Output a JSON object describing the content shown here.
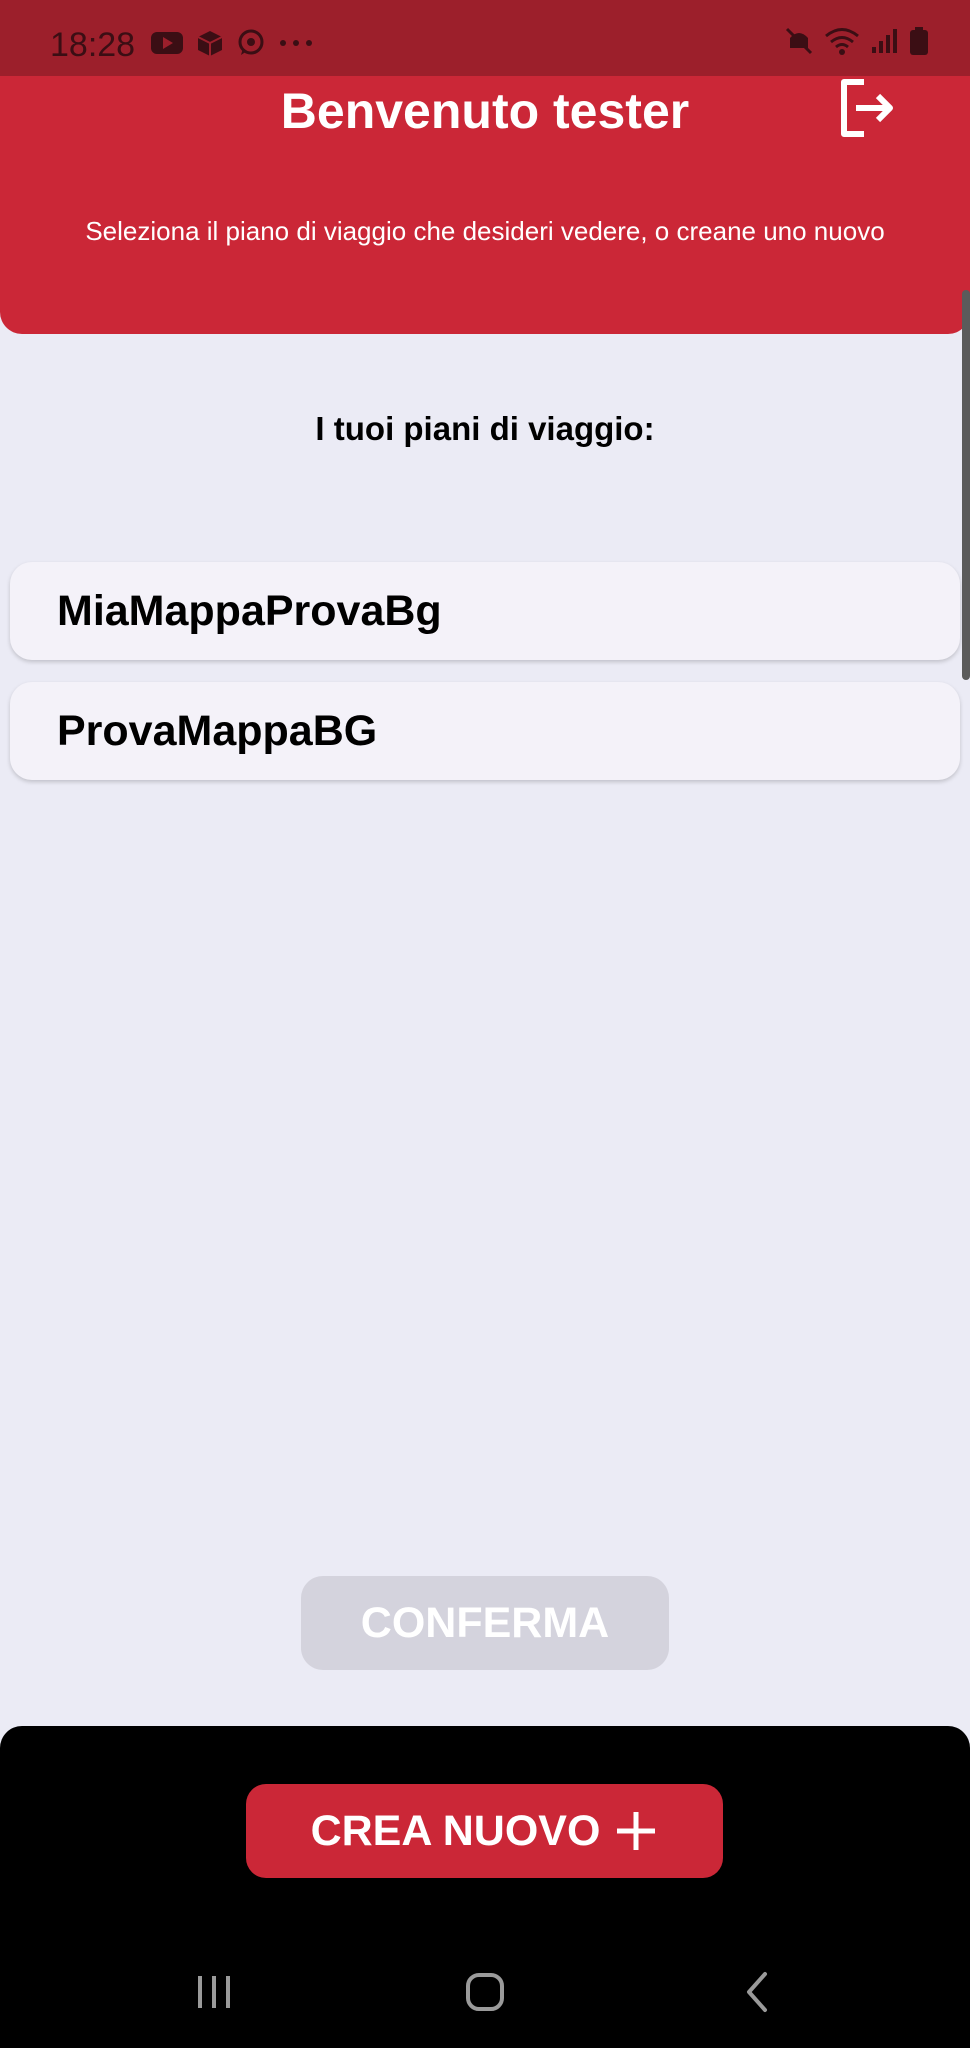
{
  "status_bar": {
    "time": "18:28"
  },
  "header": {
    "title": "Benvenuto tester",
    "subtitle": "Seleziona il piano di viaggio che desideri vedere, o creane uno nuovo"
  },
  "plans_section": {
    "title": "I tuoi piani di viaggio:",
    "plans": [
      "MiaMappaProvaBg",
      "ProvaMappaBG"
    ]
  },
  "buttons": {
    "confirm": "CONFERMA",
    "create_new": "CREA NUOVO"
  },
  "colors": {
    "primary_red": "#CB2737",
    "status_bar_red": "#9C1F2B",
    "background": "#EBEBF5",
    "disabled_button": "#D4D3DD"
  },
  "icons": {
    "logout": "logout-icon",
    "add": "plus-icon"
  }
}
